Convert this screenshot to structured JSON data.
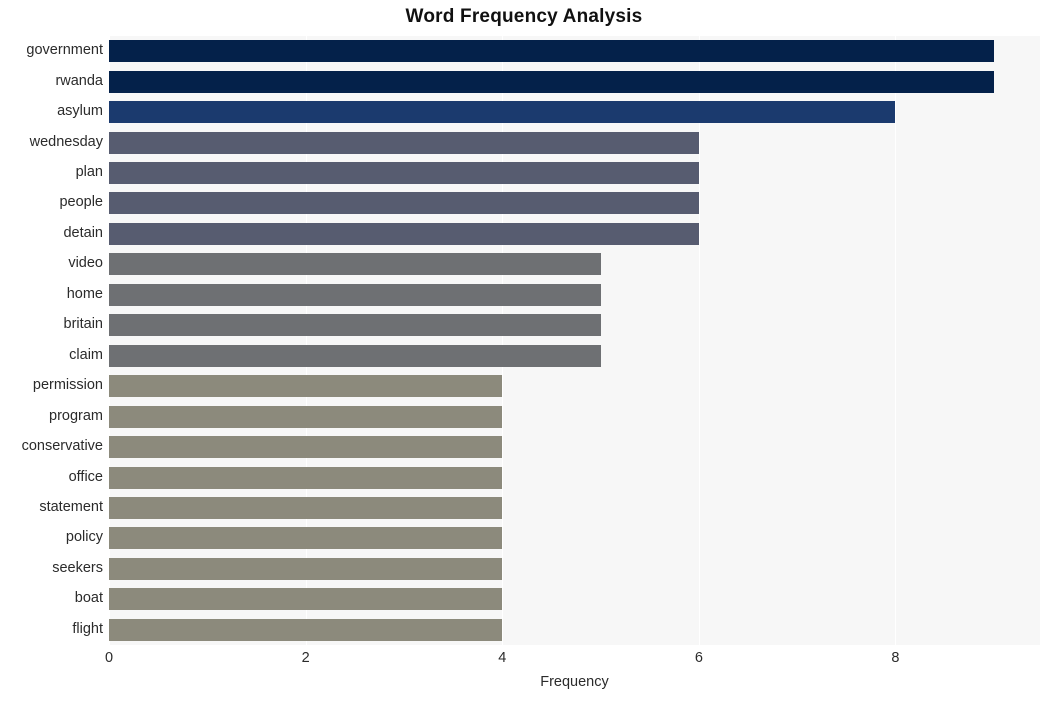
{
  "chart_data": {
    "type": "bar",
    "orientation": "horizontal",
    "title": "Word Frequency Analysis",
    "xlabel": "Frequency",
    "ylabel": "",
    "categories": [
      "government",
      "rwanda",
      "asylum",
      "wednesday",
      "plan",
      "people",
      "detain",
      "video",
      "home",
      "britain",
      "claim",
      "permission",
      "program",
      "conservative",
      "office",
      "statement",
      "policy",
      "seekers",
      "boat",
      "flight"
    ],
    "values": [
      9,
      9,
      8,
      6,
      6,
      6,
      6,
      5,
      5,
      5,
      5,
      4,
      4,
      4,
      4,
      4,
      4,
      4,
      4,
      4
    ],
    "bar_colors": [
      "#04214a",
      "#04214a",
      "#1b3a6e",
      "#575c70",
      "#575c70",
      "#575c70",
      "#575c70",
      "#6e7073",
      "#6e7073",
      "#6e7073",
      "#6e7073",
      "#8c8a7c",
      "#8c8a7c",
      "#8c8a7c",
      "#8c8a7c",
      "#8c8a7c",
      "#8c8a7c",
      "#8c8a7c",
      "#8c8a7c",
      "#8c8a7c"
    ],
    "xticks": [
      0,
      2,
      4,
      6,
      8
    ],
    "xtick_labels": [
      "0",
      "2",
      "4",
      "6",
      "8"
    ],
    "xlim": [
      0,
      9.47
    ],
    "grid": true,
    "grid_axis": "x",
    "legend": false,
    "plot_background": "#f7f7f7",
    "figure_background": "#ffffff",
    "gridline_color": "#ffffff"
  }
}
